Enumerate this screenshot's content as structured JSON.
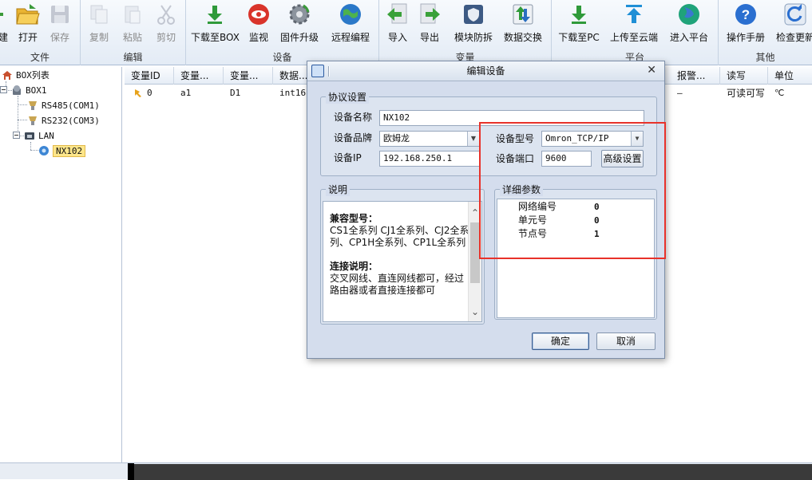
{
  "ribbon": {
    "groups": [
      {
        "label": "文件"
      },
      {
        "label": "编辑"
      },
      {
        "label": "设备"
      },
      {
        "label": "变量"
      },
      {
        "label": "平台"
      },
      {
        "label": "其他"
      }
    ],
    "buttons": {
      "new": "建",
      "open": "打开",
      "save": "保存",
      "copy": "复制",
      "paste": "粘贴",
      "cut": "剪切",
      "download_box": "下载至BOX",
      "monitor": "监视",
      "firmware": "固件升级",
      "remote": "远程编程",
      "import": "导入",
      "export": "导出",
      "module_protect": "模块防拆",
      "data_exchange": "数据交换",
      "download_pc": "下载至PC",
      "upload_cloud": "上传至云端",
      "enter_platform": "进入平台",
      "manual": "操作手册",
      "check_update": "检查更新"
    }
  },
  "tree": {
    "root": "BOX列表",
    "box": "BOX1",
    "rs485": "RS485(COM1)",
    "rs232": "RS232(COM3)",
    "lan": "LAN",
    "device": "NX102"
  },
  "grid": {
    "headers": [
      "变量ID",
      "变量...",
      "变量...",
      "数据...",
      "报警...",
      "读写",
      "单位"
    ],
    "row": {
      "id": "0",
      "name": "a1",
      "addr": "D1",
      "type": "int16",
      "alarm": "—",
      "rw": "可读可写",
      "unit": "℃"
    }
  },
  "dialog": {
    "title": "编辑设备",
    "protocol_legend": "协议设置",
    "name_label": "设备名称",
    "name_value": "NX102",
    "brand_label": "设备品牌",
    "brand_value": "欧姆龙",
    "ip_label": "设备IP",
    "ip_value": "192.168.250.1",
    "model_label": "设备型号",
    "model_value": "Omron_TCP/IP",
    "port_label": "设备端口",
    "port_value": "9600",
    "advanced_button": "高级设置",
    "desc_legend": "说明",
    "desc": {
      "compat_title": "兼容型号：",
      "compat_text": "CS1全系列 CJ1全系列、CJ2全系列、CP1H全系列、CP1L全系列",
      "conn_title": "连接说明：",
      "conn_text": "交叉网线、直连网线都可，经过路由器或者直接连接都可"
    },
    "params_legend": "详细参数",
    "params": [
      {
        "name": "网络编号",
        "value": "0"
      },
      {
        "name": "单元号",
        "value": "0"
      },
      {
        "name": "节点号",
        "value": "1"
      }
    ],
    "ok_button": "确定",
    "cancel_button": "取消"
  },
  "colors": {
    "highlight_box": "#e8322a",
    "accent": "#2b5aa0"
  }
}
